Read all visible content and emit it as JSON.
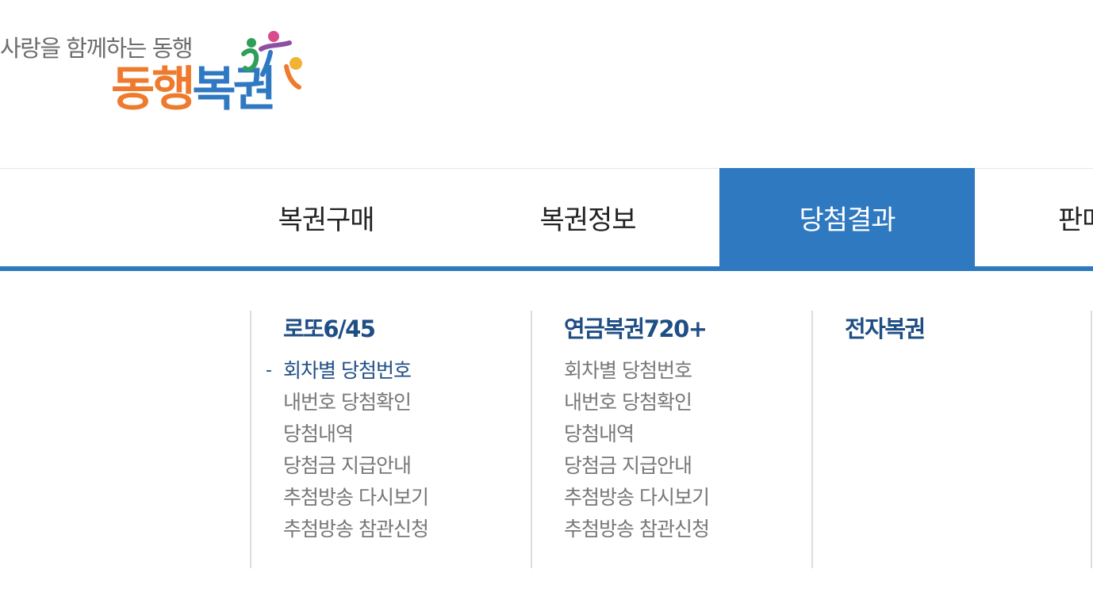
{
  "logo": {
    "tagline": "사랑을 함께하는 동행",
    "name_chars": [
      "동",
      "행",
      "복",
      "권"
    ]
  },
  "colors": {
    "accent": "#2f79c0",
    "title_text": "#1f4e85",
    "logo_orange": "#ee7b2d",
    "logo_blue": "#2f79c3",
    "menu_text": "#777777"
  },
  "gnb": {
    "tabs": [
      {
        "label": "복권구매",
        "active": false
      },
      {
        "label": "복권정보",
        "active": false
      },
      {
        "label": "당첨결과",
        "active": true
      },
      {
        "label": "판매",
        "active": false
      }
    ]
  },
  "submenu": {
    "columns": [
      {
        "title": "로또6/45",
        "items": [
          {
            "label": "회차별 당첨번호",
            "current": true,
            "marker": "-"
          },
          {
            "label": "내번호 당첨확인"
          },
          {
            "label": "당첨내역"
          },
          {
            "label": "당첨금 지급안내"
          },
          {
            "label": "추첨방송 다시보기"
          },
          {
            "label": "추첨방송 참관신청"
          }
        ]
      },
      {
        "title": "연금복권720+",
        "items": [
          {
            "label": "회차별 당첨번호"
          },
          {
            "label": "내번호 당첨확인"
          },
          {
            "label": "당첨내역"
          },
          {
            "label": "당첨금 지급안내"
          },
          {
            "label": "추첨방송 다시보기"
          },
          {
            "label": "추첨방송 참관신청"
          }
        ]
      },
      {
        "title": "전자복권",
        "items": []
      }
    ]
  }
}
